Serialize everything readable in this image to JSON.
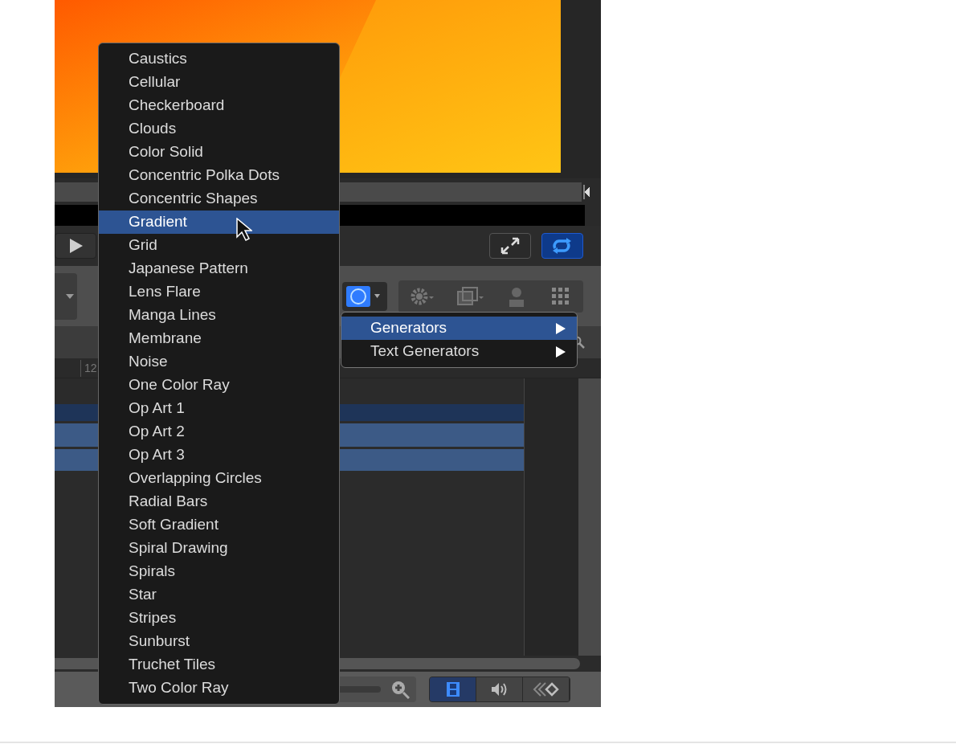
{
  "timeline": {
    "ruler_label": "12"
  },
  "generators_menu": {
    "items": [
      {
        "label": "Caustics",
        "selected": false
      },
      {
        "label": "Cellular",
        "selected": false
      },
      {
        "label": "Checkerboard",
        "selected": false
      },
      {
        "label": "Clouds",
        "selected": false
      },
      {
        "label": "Color Solid",
        "selected": false
      },
      {
        "label": "Concentric Polka Dots",
        "selected": false
      },
      {
        "label": "Concentric Shapes",
        "selected": false
      },
      {
        "label": "Gradient",
        "selected": true
      },
      {
        "label": "Grid",
        "selected": false
      },
      {
        "label": "Japanese Pattern",
        "selected": false
      },
      {
        "label": "Lens Flare",
        "selected": false
      },
      {
        "label": "Manga Lines",
        "selected": false
      },
      {
        "label": "Membrane",
        "selected": false
      },
      {
        "label": "Noise",
        "selected": false
      },
      {
        "label": "One Color Ray",
        "selected": false
      },
      {
        "label": "Op Art 1",
        "selected": false
      },
      {
        "label": "Op Art 2",
        "selected": false
      },
      {
        "label": "Op Art 3",
        "selected": false
      },
      {
        "label": "Overlapping Circles",
        "selected": false
      },
      {
        "label": "Radial Bars",
        "selected": false
      },
      {
        "label": "Soft Gradient",
        "selected": false
      },
      {
        "label": "Spiral Drawing",
        "selected": false
      },
      {
        "label": "Spirals",
        "selected": false
      },
      {
        "label": "Star",
        "selected": false
      },
      {
        "label": "Stripes",
        "selected": false
      },
      {
        "label": "Sunburst",
        "selected": false
      },
      {
        "label": "Truchet Tiles",
        "selected": false
      },
      {
        "label": "Two Color Ray",
        "selected": false
      }
    ]
  },
  "submenu": {
    "items": [
      {
        "label": "Generators",
        "selected": true
      },
      {
        "label": "Text Generators",
        "selected": false
      }
    ]
  },
  "bottom_bar": {
    "view_buttons": [
      {
        "kind": "video",
        "selected": true
      },
      {
        "kind": "audio",
        "selected": false
      },
      {
        "kind": "keyframes",
        "selected": false
      }
    ]
  }
}
